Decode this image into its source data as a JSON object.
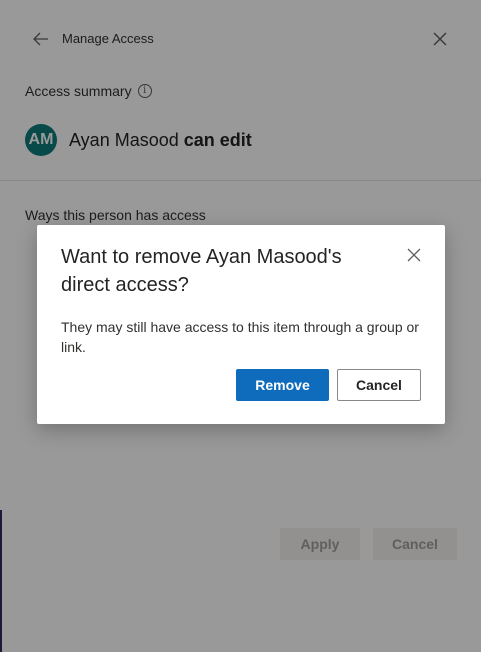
{
  "header": {
    "title": "Manage Access",
    "back_icon": "arrow-left-icon",
    "close_icon": "close-icon"
  },
  "summary": {
    "label": "Access summary",
    "info_icon": "i",
    "person": {
      "initials": "AM",
      "name": "Ayan Masood",
      "permission": "can edit",
      "avatar_color": "#0e7a7a"
    }
  },
  "ways": {
    "label": "Ways this person has access"
  },
  "footer": {
    "apply_label": "Apply",
    "cancel_label": "Cancel"
  },
  "dialog": {
    "title": "Want to remove Ayan Masood's direct access?",
    "body": "They may still have access to this item through a group or link.",
    "remove_label": "Remove",
    "cancel_label": "Cancel",
    "primary_color": "#0f6cbd"
  }
}
